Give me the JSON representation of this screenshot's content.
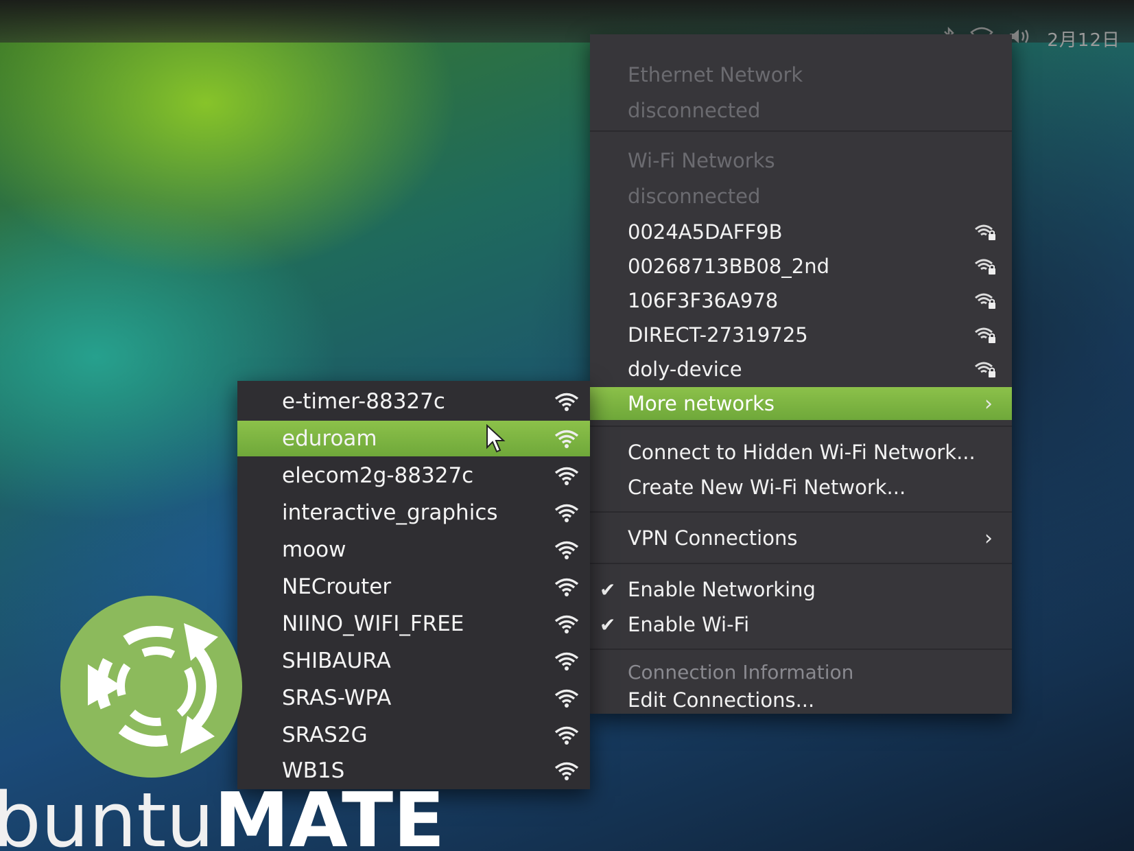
{
  "tray": {
    "clock": "2月12日"
  },
  "main_menu": {
    "ethernet_header": "Ethernet Network",
    "ethernet_status": "disconnected",
    "wifi_header": "Wi-Fi Networks",
    "wifi_status": "disconnected",
    "networks": [
      {
        "ssid": "0024A5DAFF9B",
        "secured": true
      },
      {
        "ssid": "00268713BB08_2nd",
        "secured": true
      },
      {
        "ssid": "106F3F36A978",
        "secured": true
      },
      {
        "ssid": "DIRECT-27319725",
        "secured": true
      },
      {
        "ssid": "doly-device",
        "secured": true
      }
    ],
    "more_networks": "More networks",
    "connect_hidden": "Connect to Hidden Wi-Fi Network...",
    "create_new": "Create New Wi-Fi Network...",
    "vpn": "VPN Connections",
    "enable_networking": "Enable Networking",
    "enable_wifi": "Enable Wi-Fi",
    "connection_info": "Connection Information",
    "edit_connections": "Edit Connections..."
  },
  "sub_menu": {
    "networks": [
      {
        "ssid": "e-timer-88327c"
      },
      {
        "ssid": "eduroam"
      },
      {
        "ssid": "elecom2g-88327c"
      },
      {
        "ssid": "interactive_graphics"
      },
      {
        "ssid": "moow"
      },
      {
        "ssid": "NECrouter"
      },
      {
        "ssid": "NIINO_WIFI_FREE"
      },
      {
        "ssid": "SHIBAURA"
      },
      {
        "ssid": "SRAS-WPA"
      },
      {
        "ssid": "SRAS2G"
      },
      {
        "ssid": "WB1S"
      }
    ],
    "highlighted": "eduroam"
  },
  "brand": {
    "light": "buntu",
    "bold": "MATE"
  },
  "colors": {
    "menu_bg": "#37363a",
    "submenu_bg": "#2f2e32",
    "highlight": "#7db443",
    "logo": "#8cba5c"
  }
}
